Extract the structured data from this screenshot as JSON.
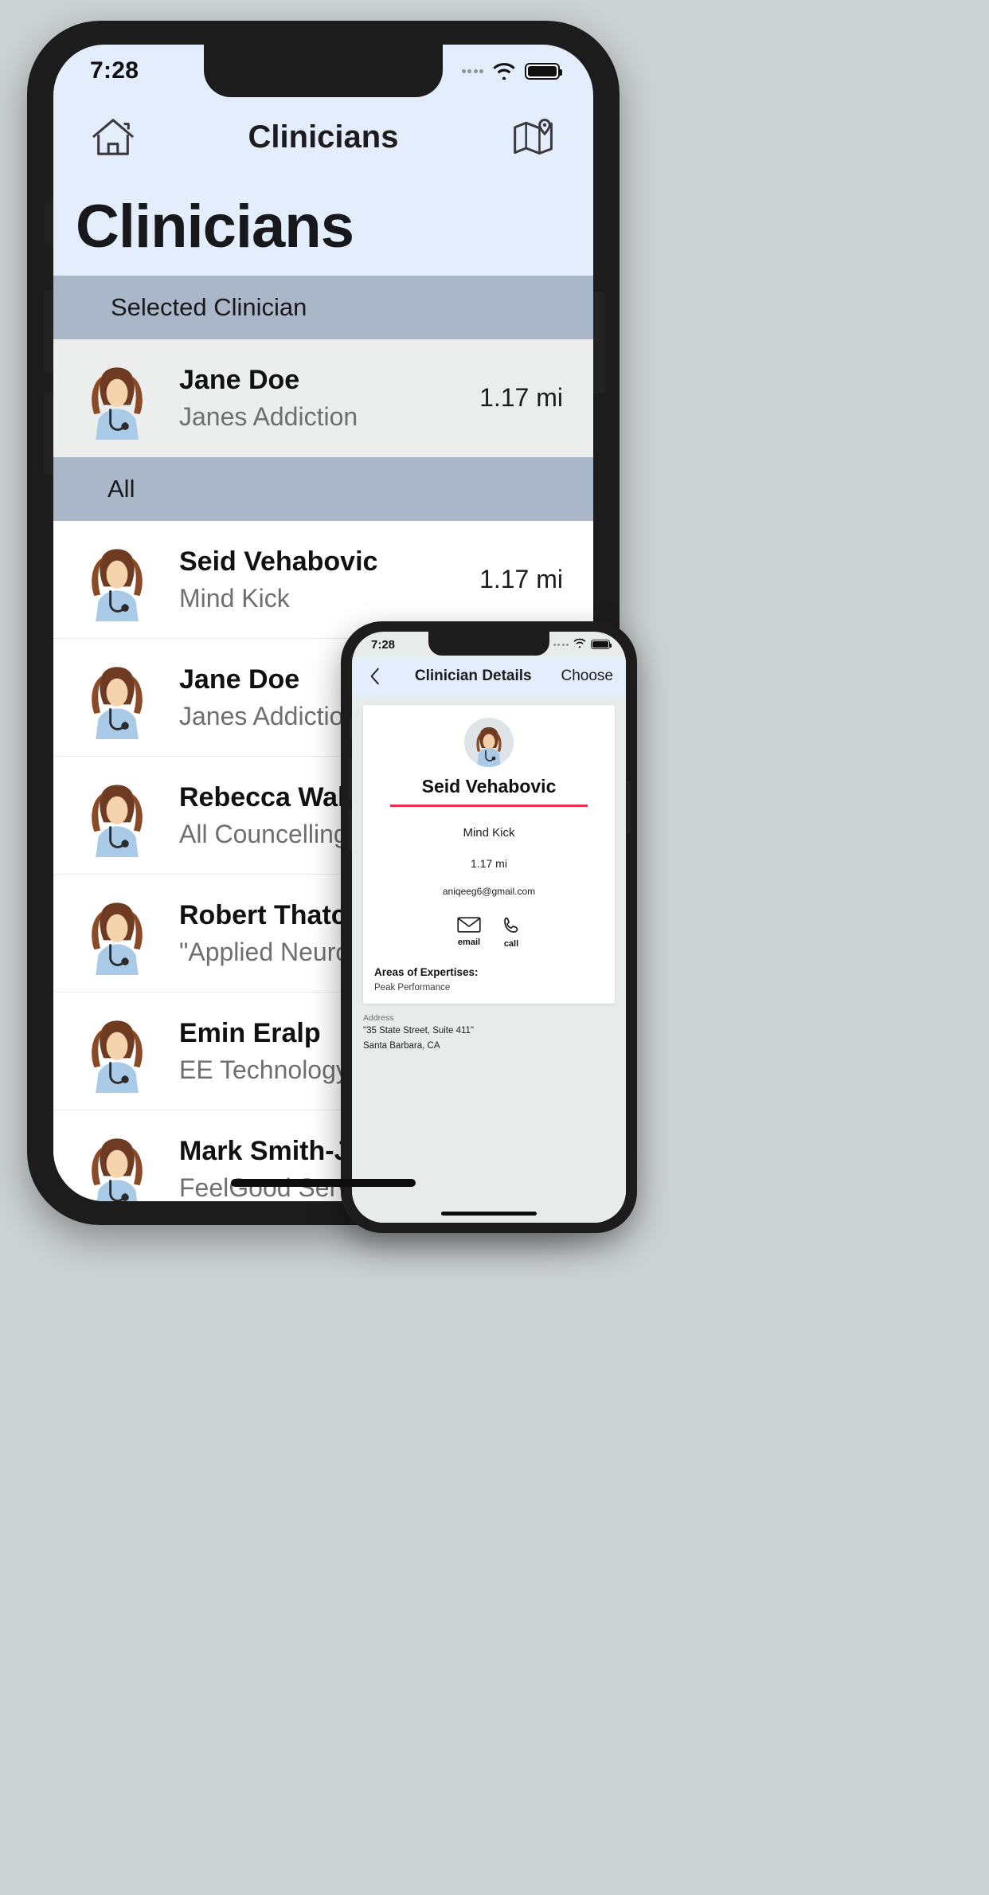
{
  "phone1": {
    "status": {
      "time": "7:28",
      "wifi_icon": "wifi-icon",
      "battery_icon": "battery-icon",
      "signal_icon": "signal-dots-icon"
    },
    "nav": {
      "home_icon": "home-icon",
      "title": "Clinicians",
      "map_icon": "map-icon"
    },
    "large_title": "Clinicians",
    "sections": [
      {
        "header": "Selected Clinician",
        "rows": [
          {
            "name": "Jane Doe",
            "org": "Janes Addiction",
            "distance": "1.17 mi",
            "avatar_icon": "clinician-avatar-icon"
          }
        ]
      },
      {
        "header": "All",
        "rows": [
          {
            "name": "Seid Vehabovic",
            "org": "Mind Kick",
            "distance": "1.17 mi",
            "avatar_icon": "clinician-avatar-icon"
          },
          {
            "name": "Jane Doe",
            "org": "Janes Addiction",
            "distance": "",
            "avatar_icon": "clinician-avatar-icon"
          },
          {
            "name": "Rebecca Walker",
            "org": "All Councelling",
            "distance": "",
            "avatar_icon": "clinician-avatar-icon"
          },
          {
            "name": "Robert Thatcher",
            "org": "\"Applied Neurosc",
            "distance": "",
            "avatar_icon": "clinician-avatar-icon"
          },
          {
            "name": "Emin Eralp",
            "org": "EE Technology",
            "distance": "",
            "avatar_icon": "clinician-avatar-icon"
          },
          {
            "name": "Mark Smith-Jone",
            "org": "FeelGood Service",
            "distance": "",
            "avatar_icon": "clinician-avatar-icon"
          }
        ]
      }
    ]
  },
  "phone2": {
    "status": {
      "time": "7:28",
      "wifi_icon": "wifi-icon",
      "battery_icon": "battery-icon",
      "signal_icon": "signal-dots-icon"
    },
    "nav": {
      "back_icon": "chevron-left-icon",
      "title": "Clinician Details",
      "action": "Choose"
    },
    "detail": {
      "avatar_icon": "clinician-avatar-icon",
      "name": "Seid Vehabovic",
      "accent_color": "#ec2f55",
      "org": "Mind Kick",
      "distance": "1.17 mi",
      "email": "aniqeeg6@gmail.com",
      "actions": [
        {
          "label": "email",
          "icon": "envelope-icon"
        },
        {
          "label": "call",
          "icon": "phone-icon"
        }
      ],
      "expertise_label": "Areas of Expertises:",
      "expertise_value": "Peak Performance",
      "address_label": "Address",
      "address_line1": "\"35 State Street, Suite 411\"",
      "address_line2": "Santa Barbara, CA"
    }
  }
}
